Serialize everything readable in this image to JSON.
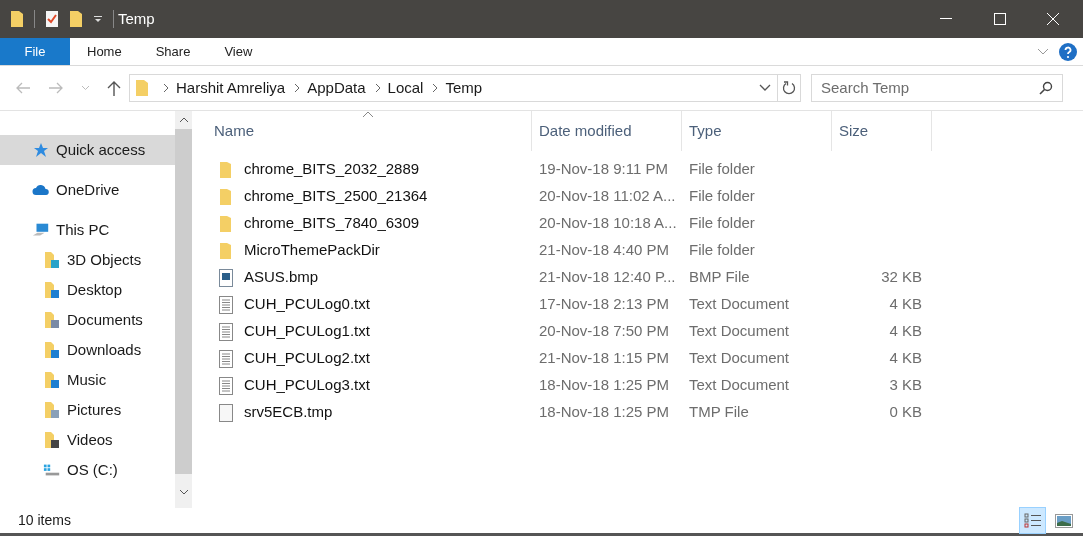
{
  "window": {
    "title": "Temp"
  },
  "ribbon_tabs": [
    {
      "label": "File",
      "selected": true
    },
    {
      "label": "Home",
      "selected": false
    },
    {
      "label": "Share",
      "selected": false
    },
    {
      "label": "View",
      "selected": false
    }
  ],
  "breadcrumb": [
    "Harshit Amreliya",
    "AppData",
    "Local",
    "Temp"
  ],
  "search": {
    "placeholder": "Search Temp"
  },
  "nav_pane": [
    {
      "label": "Quick access",
      "kind": "star",
      "selected": true
    },
    {
      "label": "OneDrive",
      "kind": "cloud",
      "selected": false
    },
    {
      "label": "This PC",
      "kind": "pc",
      "selected": false,
      "children": [
        {
          "label": "3D Objects",
          "kind": "folder",
          "selected": false
        },
        {
          "label": "Desktop",
          "kind": "folder",
          "selected": false
        },
        {
          "label": "Documents",
          "kind": "folder",
          "selected": false
        },
        {
          "label": "Downloads",
          "kind": "folder",
          "selected": false
        },
        {
          "label": "Music",
          "kind": "folder",
          "selected": false
        },
        {
          "label": "Pictures",
          "kind": "folder",
          "selected": false
        },
        {
          "label": "Videos",
          "kind": "folder",
          "selected": false
        },
        {
          "label": "OS (C:)",
          "kind": "drive",
          "selected": false
        }
      ]
    }
  ],
  "table": {
    "columns": [
      "Name",
      "Date modified",
      "Type",
      "Size"
    ],
    "rows": [
      {
        "kind": "folder",
        "name": "chrome_BITS_2032_2889",
        "date": "19-Nov-18 9:11 PM",
        "type": "File folder",
        "size": ""
      },
      {
        "kind": "folder",
        "name": "chrome_BITS_2500_21364",
        "date": "20-Nov-18 11:02 A...",
        "type": "File folder",
        "size": ""
      },
      {
        "kind": "folder",
        "name": "chrome_BITS_7840_6309",
        "date": "20-Nov-18 10:18 A...",
        "type": "File folder",
        "size": ""
      },
      {
        "kind": "folder",
        "name": "MicroThemePackDir",
        "date": "21-Nov-18 4:40 PM",
        "type": "File folder",
        "size": ""
      },
      {
        "kind": "image",
        "name": "ASUS.bmp",
        "date": "21-Nov-18 12:40 P...",
        "type": "BMP File",
        "size": "32 KB"
      },
      {
        "kind": "text",
        "name": "CUH_PCULog0.txt",
        "date": "17-Nov-18 2:13 PM",
        "type": "Text Document",
        "size": "4 KB"
      },
      {
        "kind": "text",
        "name": "CUH_PCULog1.txt",
        "date": "20-Nov-18 7:50 PM",
        "type": "Text Document",
        "size": "4 KB"
      },
      {
        "kind": "text",
        "name": "CUH_PCULog2.txt",
        "date": "21-Nov-18 1:15 PM",
        "type": "Text Document",
        "size": "4 KB"
      },
      {
        "kind": "text",
        "name": "CUH_PCULog3.txt",
        "date": "18-Nov-18 1:25 PM",
        "type": "Text Document",
        "size": "3 KB"
      },
      {
        "kind": "blank",
        "name": "srv5ECB.tmp",
        "date": "18-Nov-18 1:25 PM",
        "type": "TMP File",
        "size": "0 KB"
      }
    ]
  },
  "status_bar": {
    "count": "10 items",
    "views": [
      {
        "kind": "details",
        "selected": true
      },
      {
        "kind": "thumbnails",
        "selected": false
      }
    ]
  }
}
